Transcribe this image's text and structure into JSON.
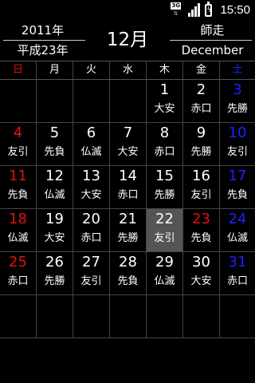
{
  "status_bar": {
    "network": "3G",
    "time": "15:50"
  },
  "header": {
    "year": "2011年",
    "era_year": "平成23年",
    "month": "12月",
    "jp_month": "師走",
    "en_month": "December"
  },
  "weekdays": [
    "日",
    "月",
    "火",
    "水",
    "木",
    "金",
    "土"
  ],
  "colors": {
    "sunday": "#e21010",
    "saturday": "#2020ff",
    "today_bg": "#555555"
  },
  "weeks": [
    [
      {
        "day": "",
        "rokuyo": ""
      },
      {
        "day": "",
        "rokuyo": ""
      },
      {
        "day": "",
        "rokuyo": ""
      },
      {
        "day": "",
        "rokuyo": ""
      },
      {
        "day": "1",
        "rokuyo": "大安"
      },
      {
        "day": "2",
        "rokuyo": "赤口"
      },
      {
        "day": "3",
        "rokuyo": "先勝"
      }
    ],
    [
      {
        "day": "4",
        "rokuyo": "友引"
      },
      {
        "day": "5",
        "rokuyo": "先負"
      },
      {
        "day": "6",
        "rokuyo": "仏滅"
      },
      {
        "day": "7",
        "rokuyo": "大安"
      },
      {
        "day": "8",
        "rokuyo": "赤口"
      },
      {
        "day": "9",
        "rokuyo": "先勝"
      },
      {
        "day": "10",
        "rokuyo": "友引"
      }
    ],
    [
      {
        "day": "11",
        "rokuyo": "先負"
      },
      {
        "day": "12",
        "rokuyo": "仏滅"
      },
      {
        "day": "13",
        "rokuyo": "大安"
      },
      {
        "day": "14",
        "rokuyo": "赤口"
      },
      {
        "day": "15",
        "rokuyo": "先勝"
      },
      {
        "day": "16",
        "rokuyo": "友引"
      },
      {
        "day": "17",
        "rokuyo": "先負"
      }
    ],
    [
      {
        "day": "18",
        "rokuyo": "仏滅"
      },
      {
        "day": "19",
        "rokuyo": "大安"
      },
      {
        "day": "20",
        "rokuyo": "赤口"
      },
      {
        "day": "21",
        "rokuyo": "先勝"
      },
      {
        "day": "22",
        "rokuyo": "友引",
        "today": true
      },
      {
        "day": "23",
        "rokuyo": "先負",
        "holiday": true
      },
      {
        "day": "24",
        "rokuyo": "仏滅"
      }
    ],
    [
      {
        "day": "25",
        "rokuyo": "赤口"
      },
      {
        "day": "26",
        "rokuyo": "先勝"
      },
      {
        "day": "27",
        "rokuyo": "友引"
      },
      {
        "day": "28",
        "rokuyo": "先負"
      },
      {
        "day": "29",
        "rokuyo": "仏滅"
      },
      {
        "day": "30",
        "rokuyo": "大安"
      },
      {
        "day": "31",
        "rokuyo": "赤口"
      }
    ],
    [
      {
        "day": "",
        "rokuyo": ""
      },
      {
        "day": "",
        "rokuyo": ""
      },
      {
        "day": "",
        "rokuyo": ""
      },
      {
        "day": "",
        "rokuyo": ""
      },
      {
        "day": "",
        "rokuyo": ""
      },
      {
        "day": "",
        "rokuyo": ""
      },
      {
        "day": "",
        "rokuyo": ""
      }
    ]
  ]
}
